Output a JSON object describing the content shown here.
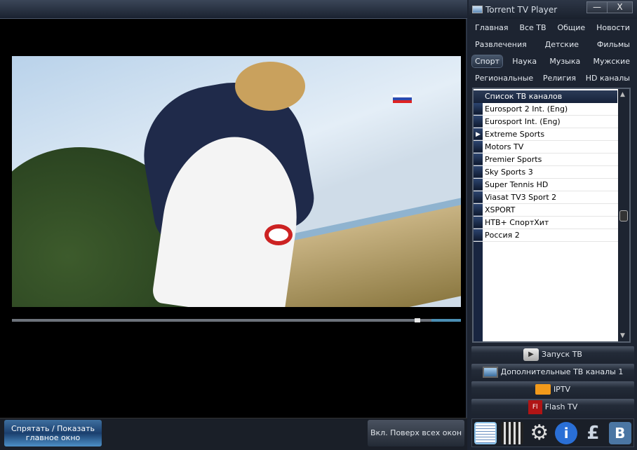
{
  "app": {
    "title": "Torrent TV Player",
    "minimize": "—",
    "close": "X"
  },
  "categories": [
    [
      {
        "label": "Главная"
      },
      {
        "label": "Все ТВ"
      },
      {
        "label": "Общие"
      },
      {
        "label": "Новости"
      }
    ],
    [
      {
        "label": "Развлечения"
      },
      {
        "label": "Детские"
      },
      {
        "label": "Фильмы"
      }
    ],
    [
      {
        "label": "Спорт",
        "active": true
      },
      {
        "label": "Наука"
      },
      {
        "label": "Музыка"
      },
      {
        "label": "Мужские"
      }
    ],
    [
      {
        "label": "Региональные"
      },
      {
        "label": "Религия"
      },
      {
        "label": "HD каналы"
      }
    ]
  ],
  "channel_list": {
    "header": "Список ТВ каналов",
    "selected": "Extreme Sports",
    "items": [
      "Eurosport 2 Int. (Eng)",
      "Eurosport Int. (Eng)",
      "Extreme Sports",
      "Motors TV",
      "Premier Sports",
      "Sky Sports 3",
      "Super Tennis HD",
      "Viasat TV3 Sport 2",
      "XSPORT",
      "НТВ+ СпортХит",
      "Россия 2"
    ]
  },
  "actions": {
    "start_tv": "Запуск ТВ",
    "extra_channels": "Дополнительные ТВ каналы 1",
    "iptv": "IPTV",
    "flash_tv": "Flash TV"
  },
  "player": {
    "progress": 0.94,
    "hide_show_line1": "Спрятать / Показать",
    "hide_show_line2": "главное окно",
    "always_on_top": "Вкл. Поверх всех окон"
  },
  "toolbar_icons": [
    "list-icon",
    "clapperboard-icon",
    "gear-icon",
    "info-icon",
    "pound-icon",
    "vk-icon"
  ],
  "toolbar_glyphs": {
    "info": "i",
    "pound": "£",
    "vk": "B"
  }
}
